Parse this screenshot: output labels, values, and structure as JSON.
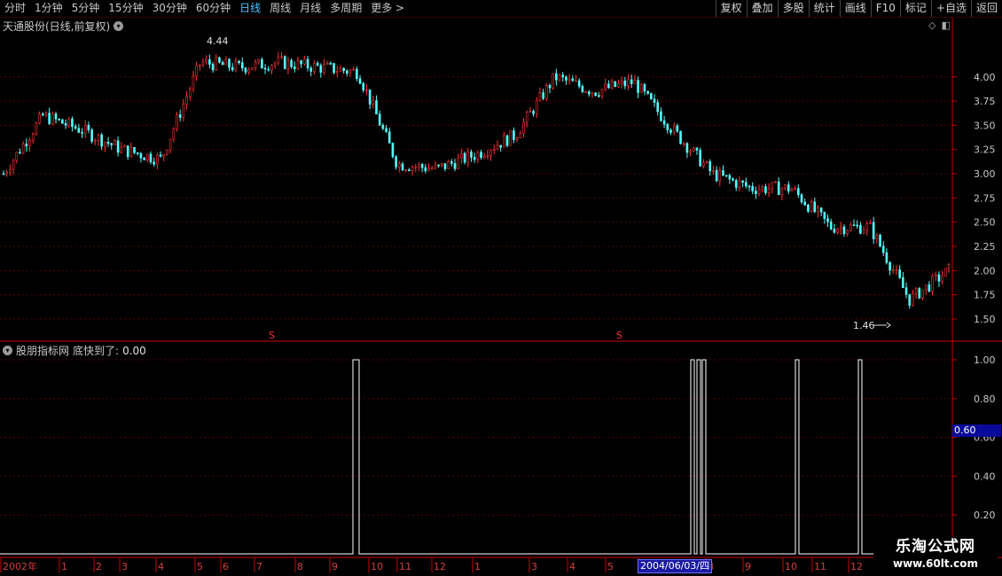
{
  "toolbar": {
    "tabs": [
      "分时",
      "1分钟",
      "5分钟",
      "15分钟",
      "30分钟",
      "60分钟",
      "日线",
      "周线",
      "月线",
      "多周期",
      "更多 >"
    ],
    "active_tab": "日线",
    "tools": [
      "复权",
      "叠加",
      "多股",
      "统计",
      "画线",
      "F10",
      "标记",
      "+自选",
      "返回"
    ]
  },
  "stock": {
    "title": "天通股份(日线,前复权)"
  },
  "indicator": {
    "name": "股朋指标网",
    "label": "底快到了:",
    "value": "0.00"
  },
  "price_axis": {
    "ticks": [
      "4.00",
      "3.75",
      "3.50",
      "3.25",
      "3.00",
      "2.75",
      "2.50",
      "2.25",
      "2.00",
      "1.75",
      "1.50"
    ]
  },
  "indicator_axis": {
    "ticks": [
      "1.00",
      "0.80",
      "0.60",
      "0.40",
      "0.20"
    ],
    "current": "0.60"
  },
  "annotations": {
    "high": "4.44",
    "low": "1.46",
    "markers": [
      "S",
      "S"
    ]
  },
  "date_axis": {
    "labels": [
      "2002年",
      "1",
      "2",
      "3",
      "4",
      "5",
      "6",
      "7",
      "8",
      "9",
      "10",
      "11",
      "12",
      "1",
      "3",
      "4",
      "5",
      "6",
      "8",
      "9",
      "10",
      "11",
      "12"
    ],
    "cursor_date": "2004/06/03/四"
  },
  "colors": {
    "up": "#ff3232",
    "down": "#54ffff",
    "grid": "#5a0000",
    "axis": "#c80000",
    "signal": "#ffffff"
  },
  "brand": {
    "name": "乐淘公式网",
    "url": "www.60lt.com"
  },
  "chart_data": {
    "type": "candlestick",
    "price_ylim": [
      1.4,
      4.5
    ],
    "high_label_value": 4.44,
    "low_label_value": 1.46,
    "indicator": {
      "name": "底快到了",
      "ylim": [
        0,
        1
      ],
      "signal_clusters_by_month": [
        "2003-10",
        "2004-06",
        "2004-06",
        "2004-06",
        "2004-10",
        "2004-12"
      ],
      "signal_value": 1.0
    },
    "close_path_by_month": [
      {
        "month": "2002-12",
        "close": 3.0
      },
      {
        "month": "2003-01",
        "close": 3.6
      },
      {
        "month": "2003-02",
        "close": 3.45
      },
      {
        "month": "2003-03",
        "close": 3.25
      },
      {
        "month": "2003-04",
        "close": 3.15
      },
      {
        "month": "2003-05",
        "close": 4.15
      },
      {
        "month": "2003-06",
        "close": 4.1
      },
      {
        "month": "2003-07",
        "close": 4.15
      },
      {
        "month": "2003-08",
        "close": 4.1
      },
      {
        "month": "2003-09",
        "close": 4.05
      },
      {
        "month": "2003-10",
        "close": 3.1
      },
      {
        "month": "2003-11",
        "close": 3.05
      },
      {
        "month": "2003-12",
        "close": 3.2
      },
      {
        "month": "2004-01",
        "close": 3.4
      },
      {
        "month": "2004-02",
        "close": 4.0
      },
      {
        "month": "2004-03",
        "close": 3.85
      },
      {
        "month": "2004-04",
        "close": 3.95
      },
      {
        "month": "2004-05",
        "close": 3.45
      },
      {
        "month": "2004-06",
        "close": 3.0
      },
      {
        "month": "2004-07",
        "close": 2.85
      },
      {
        "month": "2004-08",
        "close": 2.85
      },
      {
        "month": "2004-09",
        "close": 2.45
      },
      {
        "month": "2004-10",
        "close": 2.45
      },
      {
        "month": "2004-11",
        "close": 1.7
      },
      {
        "month": "2004-12",
        "close": 2.0
      }
    ]
  }
}
